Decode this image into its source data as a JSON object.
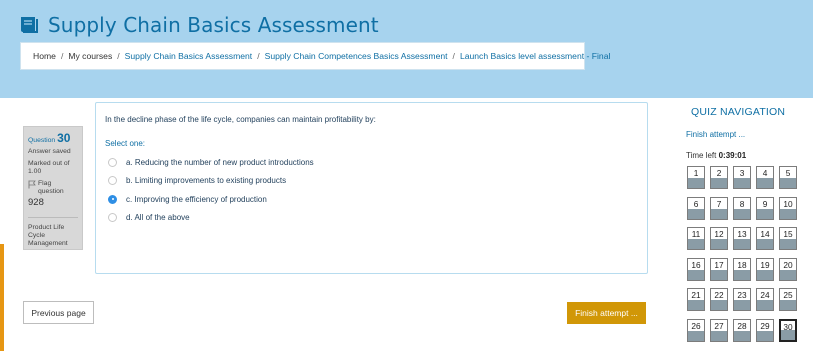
{
  "header": {
    "course_title": "Supply Chain Basics Assessment",
    "breadcrumb": [
      "Home",
      "My courses",
      "Supply Chain Basics Assessment",
      "Supply Chain Competences Basics Assessment",
      "Launch Basics level assessment - Final"
    ]
  },
  "question_info": {
    "label": "Question",
    "number": "30",
    "status": "Answer saved",
    "marked_out_of": "Marked out of 1.00",
    "flag_label": "Flag question",
    "question_id": "928",
    "category": "Product Life Cycle Management"
  },
  "question": {
    "text": "In the decline phase of the life cycle, companies can maintain profitability by:",
    "prompt": "Select one:",
    "options": [
      {
        "label": "a. Reducing the number of new product introductions"
      },
      {
        "label": "b. Limiting improvements to existing products"
      },
      {
        "label": "c. Improving the efficiency of production"
      },
      {
        "label": "d. All of the above"
      }
    ],
    "selected_index": 2
  },
  "buttons": {
    "previous": "Previous page",
    "finish": "Finish attempt ..."
  },
  "quiz_nav": {
    "title": "QUIZ NAVIGATION",
    "finish_link": "Finish attempt ...",
    "time_left_label": "Time left",
    "time_left": "0:39:01",
    "questions": [
      "1",
      "2",
      "3",
      "4",
      "5",
      "6",
      "7",
      "8",
      "9",
      "10",
      "11",
      "12",
      "13",
      "14",
      "15",
      "16",
      "17",
      "18",
      "19",
      "20",
      "21",
      "22",
      "23",
      "24",
      "25",
      "26",
      "27",
      "28",
      "29",
      "30"
    ],
    "current": "30"
  },
  "colors": {
    "header_bg": "#a7d3ee",
    "link": "#0f6fa4",
    "finish_button": "#d19707",
    "radio_checked": "#2f8fe5",
    "accent_bar": "#e69613"
  },
  "icons": {
    "title": "book-icon",
    "flag": "flag-icon"
  }
}
